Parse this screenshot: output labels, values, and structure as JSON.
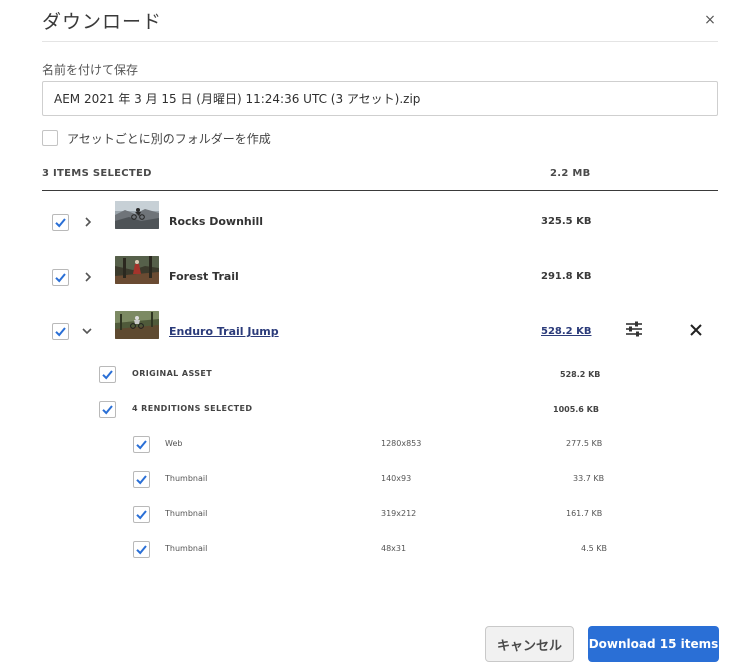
{
  "dialog": {
    "title": "ダウンロード",
    "close_glyph": "×"
  },
  "save_as": {
    "label": "名前を付けて保存",
    "value": "AEM 2021 年 3 月 15 日 (月曜日) 11:24:36 UTC (3 アセット).zip"
  },
  "folder_option": {
    "label": "アセットごとに別のフォルダーを作成",
    "checked": false
  },
  "list_header": {
    "selected_count": "3 ITEMS SELECTED",
    "total_size": "2.2 MB"
  },
  "assets": [
    {
      "name": "Rocks Downhill",
      "size": "325.5 KB",
      "checked": true,
      "expanded": false,
      "thumb_icon": "mountain-bike-photo"
    },
    {
      "name": "Forest Trail",
      "size": "291.8 KB",
      "checked": true,
      "expanded": false,
      "thumb_icon": "forest-trail-photo"
    },
    {
      "name": "Enduro Trail Jump",
      "size": "528.2 KB",
      "checked": true,
      "expanded": true,
      "thumb_icon": "trail-jump-photo"
    }
  ],
  "expanded_asset": {
    "original": {
      "label": "ORIGINAL ASSET",
      "size": "528.2 KB",
      "checked": true
    },
    "renditions_group": {
      "label": "4 RENDITIONS SELECTED",
      "size": "1005.6 KB",
      "checked": true
    },
    "renditions": [
      {
        "name": "Web",
        "dimensions": "1280x853",
        "size": "277.5 KB",
        "checked": true
      },
      {
        "name": "Thumbnail",
        "dimensions": "140x93",
        "size": "33.7 KB",
        "checked": true
      },
      {
        "name": "Thumbnail",
        "dimensions": "319x212",
        "size": "161.7 KB",
        "checked": true
      },
      {
        "name": "Thumbnail",
        "dimensions": "48x31",
        "size": "4.5 KB",
        "checked": true
      }
    ]
  },
  "actions": {
    "cancel_label": "キャンセル",
    "download_label": "Download 15 items"
  },
  "colors": {
    "accent": "#2a6fd6",
    "check": "#2a6fd6",
    "link": "#2b3b7a"
  }
}
